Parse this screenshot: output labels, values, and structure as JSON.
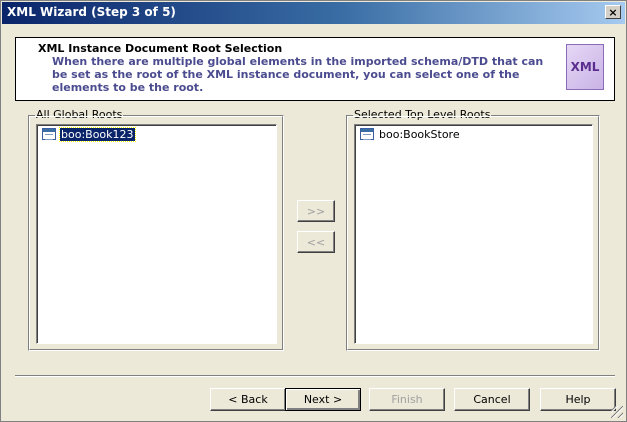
{
  "window": {
    "title": "XML Wizard (Step 3 of 5)",
    "close_label": "×"
  },
  "header": {
    "title": "XML Instance Document Root Selection",
    "description": "When there are multiple global elements in the imported schema/DTD that can be set as the root of the XML instance document, you can select one of the elements to be the root.",
    "logo_text": "XML"
  },
  "all_roots": {
    "label": "All Global Roots",
    "items": [
      {
        "label": "boo:Book123",
        "selected": true
      }
    ]
  },
  "selected_roots": {
    "label": "Selected Top Level Roots",
    "items": [
      {
        "label": "boo:BookStore",
        "selected": false
      }
    ]
  },
  "move_buttons": {
    "add_label": ">>",
    "remove_label": "<<"
  },
  "footer": {
    "back_label": "< Back",
    "next_label": "Next >",
    "finish_label": "Finish",
    "cancel_label": "Cancel",
    "help_label": "Help"
  }
}
